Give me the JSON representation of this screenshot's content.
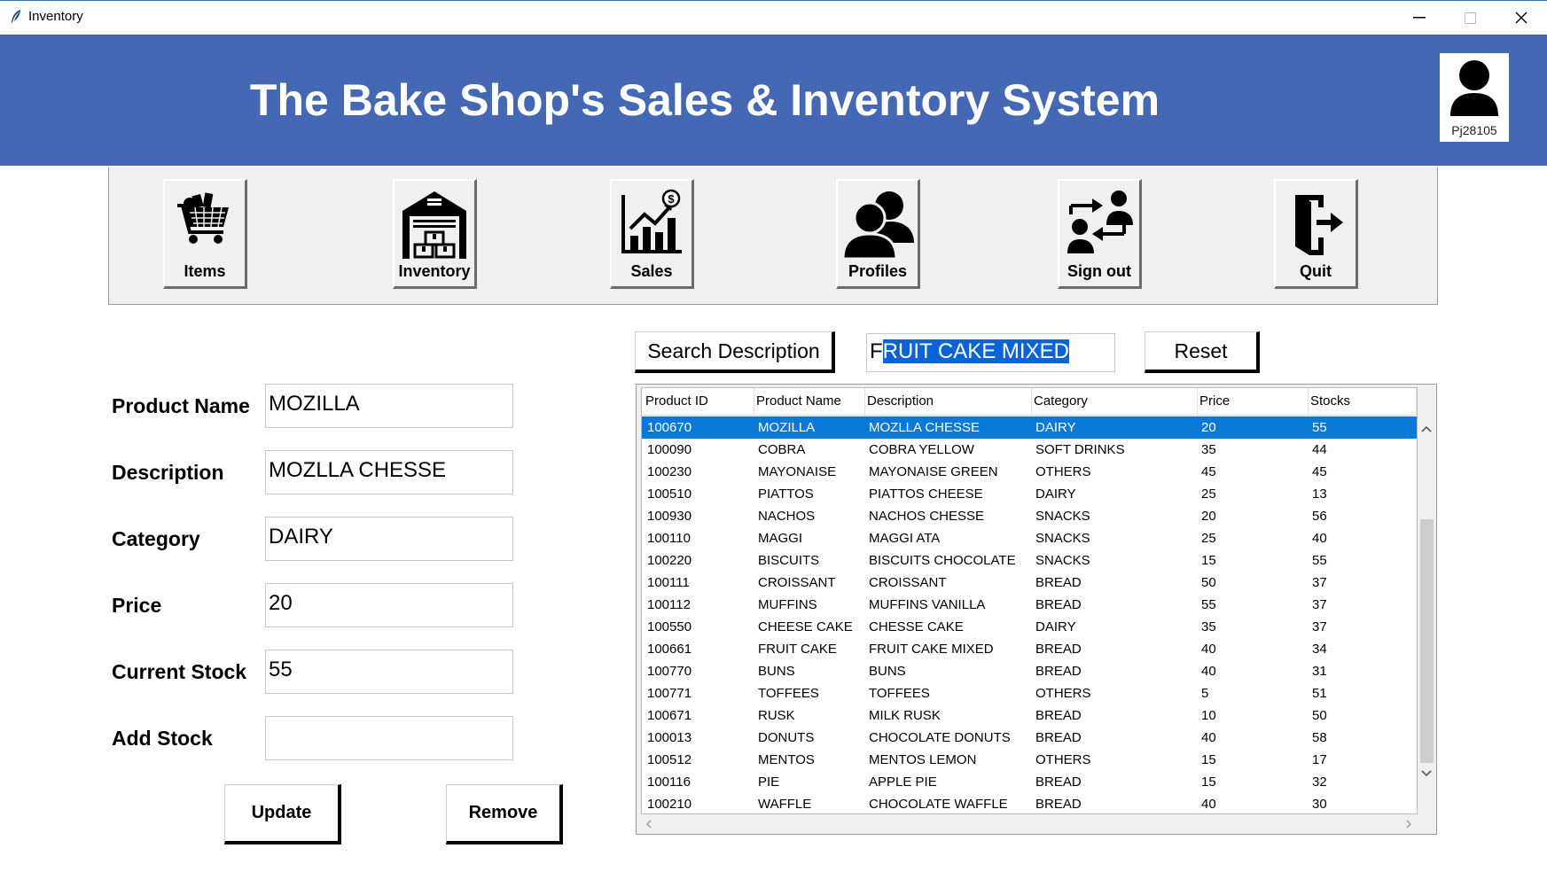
{
  "window": {
    "title": "Inventory"
  },
  "header": {
    "title": "The Bake Shop's Sales & Inventory System",
    "username": "Pj28105"
  },
  "nav": [
    {
      "label": "Items",
      "icon": "shopping-cart-icon"
    },
    {
      "label": "Inventory",
      "icon": "warehouse-icon"
    },
    {
      "label": "Sales",
      "icon": "sales-chart-icon"
    },
    {
      "label": "Profiles",
      "icon": "users-icon"
    },
    {
      "label": "Sign out",
      "icon": "switch-user-icon"
    },
    {
      "label": "Quit",
      "icon": "exit-door-icon"
    }
  ],
  "form": {
    "product_name_label": "Product Name",
    "product_name_value": "MOZILLA",
    "description_label": "Description",
    "description_value": "MOZLLA CHESSE",
    "category_label": "Category",
    "category_value": "DAIRY",
    "price_label": "Price",
    "price_value": "20",
    "current_stock_label": "Current Stock",
    "current_stock_value": "55",
    "add_stock_label": "Add Stock",
    "add_stock_value": "",
    "update_label": "Update",
    "remove_label": "Remove"
  },
  "search": {
    "button_label": "Search Description",
    "value_prefix": "F",
    "value_selected": "RUIT CAKE MIXED",
    "reset_label": "Reset"
  },
  "table": {
    "columns": [
      "Product ID",
      "Product Name",
      "Description",
      "Category",
      "Price",
      "Stocks"
    ],
    "selected_row": 0,
    "rows": [
      [
        "100670",
        "MOZILLA",
        "MOZLLA CHESSE",
        "DAIRY",
        "20",
        "55"
      ],
      [
        "100090",
        "COBRA",
        "COBRA YELLOW",
        "SOFT DRINKS",
        "35",
        "44"
      ],
      [
        "100230",
        "MAYONAISE",
        "MAYONAISE GREEN",
        "OTHERS",
        "45",
        "45"
      ],
      [
        "100510",
        "PIATTOS",
        "PIATTOS CHEESE",
        "DAIRY",
        "25",
        "13"
      ],
      [
        "100930",
        "NACHOS",
        "NACHOS CHESSE",
        "SNACKS",
        "20",
        "56"
      ],
      [
        "100110",
        "MAGGI",
        "MAGGI ATA",
        "SNACKS",
        "25",
        "40"
      ],
      [
        "100220",
        "BISCUITS",
        "BISCUITS CHOCOLATE",
        "SNACKS",
        "15",
        "55"
      ],
      [
        "100111",
        "CROISSANT",
        "CROISSANT",
        "BREAD",
        "50",
        "37"
      ],
      [
        "100112",
        "MUFFINS",
        "MUFFINS VANILLA",
        "BREAD",
        "55",
        "37"
      ],
      [
        "100550",
        "CHEESE CAKE",
        "CHESSE CAKE",
        "DAIRY",
        "35",
        "37"
      ],
      [
        "100661",
        "FRUIT CAKE",
        "FRUIT CAKE MIXED",
        "BREAD",
        "40",
        "34"
      ],
      [
        "100770",
        "BUNS",
        "BUNS",
        "BREAD",
        "40",
        "31"
      ],
      [
        "100771",
        "TOFFEES",
        "TOFFEES",
        "OTHERS",
        "5",
        "51"
      ],
      [
        "100671",
        "RUSK",
        "MILK RUSK",
        "BREAD",
        "10",
        "50"
      ],
      [
        "100013",
        "DONUTS",
        "CHOCOLATE DONUTS",
        "BREAD",
        "40",
        "58"
      ],
      [
        "100512",
        "MENTOS",
        "MENTOS LEMON",
        "OTHERS",
        "15",
        "17"
      ],
      [
        "100116",
        "PIE",
        "APPLE PIE",
        "BREAD",
        "15",
        "32"
      ],
      [
        "100210",
        "WAFFLE",
        "CHOCOLATE WAFFLE",
        "BREAD",
        "40",
        "30"
      ]
    ]
  },
  "colors": {
    "header_bg": "#4468b4",
    "selection": "#0a78d7"
  }
}
